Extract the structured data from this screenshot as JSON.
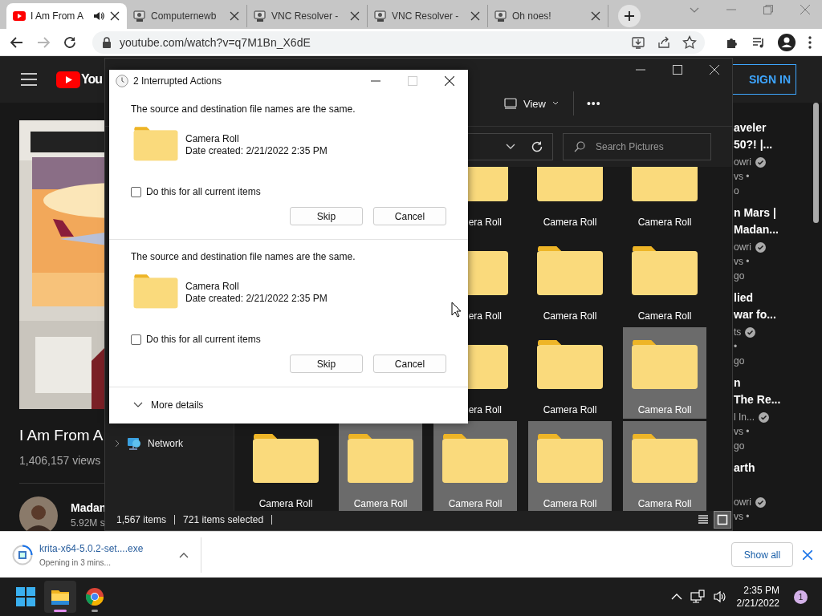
{
  "browser": {
    "tabs": [
      {
        "title": "I Am From A",
        "kind": "video",
        "audio": true,
        "selected": true
      },
      {
        "title": "Computernewb",
        "kind": "vnc",
        "audio": false,
        "selected": false
      },
      {
        "title": "VNC Resolver -",
        "kind": "vnc",
        "audio": false,
        "selected": false
      },
      {
        "title": "VNC Resolver -",
        "kind": "vnc",
        "audio": false,
        "selected": false
      },
      {
        "title": "Oh noes!",
        "kind": "vnc",
        "audio": false,
        "selected": false
      }
    ],
    "forward_disabled": true,
    "url": "youtube.com/watch?v=q7M1Bn_X6dE"
  },
  "youtube": {
    "logo": "You",
    "sign_in": "SIGN IN",
    "video": {
      "title": "I Am From A",
      "views": "1,406,157 views",
      "channel": "Madan",
      "subscribers": "5.92M s"
    },
    "suggestions": [
      {
        "title": [
          "aveler",
          "50?! |..."
        ],
        "meta": [
          {
            "text": "owri",
            "verified": true
          },
          {
            "text": "vs •",
            "verified": false
          },
          {
            "text": "o",
            "verified": false
          }
        ]
      },
      {
        "title": [
          "n Mars |",
          "Madan..."
        ],
        "meta": [
          {
            "text": "owri",
            "verified": true
          },
          {
            "text": "vs •",
            "verified": false
          },
          {
            "text": "go",
            "verified": false
          }
        ]
      },
      {
        "title": [
          "lied",
          "war fo..."
        ],
        "meta": [
          {
            "text": "ts",
            "verified": true
          },
          {
            "text": "•",
            "verified": false
          },
          {
            "text": "go",
            "verified": false
          }
        ]
      },
      {
        "title": [
          "n",
          "The Re..."
        ],
        "meta": [
          {
            "text": "l In...",
            "verified": true
          },
          {
            "text": "vs •",
            "verified": false
          },
          {
            "text": "go",
            "verified": false
          }
        ]
      },
      {
        "title": [
          "arth"
        ],
        "meta": [
          {
            "text": "owri",
            "verified": true
          },
          {
            "text": "vs •",
            "verified": false
          }
        ]
      }
    ]
  },
  "explorer": {
    "view": "View",
    "more": "•••",
    "search": {
      "placeholder": "Search Pictures"
    },
    "nav": [
      {
        "label": "Network",
        "expanded": false
      }
    ],
    "rows": [
      [
        "",
        "",
        {
          "label": "era Roll",
          "kind": "cut",
          "selected": false
        },
        {
          "label": "Camera Roll",
          "kind": "full",
          "selected": false
        },
        {
          "label": "Camera Roll",
          "kind": "full",
          "selected": false
        }
      ],
      [
        "",
        "",
        {
          "label": "era Roll",
          "kind": "cut",
          "selected": false
        },
        {
          "label": "Camera Roll",
          "kind": "full",
          "selected": false
        },
        {
          "label": "Camera Roll",
          "kind": "full",
          "selected": false
        }
      ],
      [
        "",
        "",
        {
          "label": "era Roll",
          "kind": "cut",
          "selected": false
        },
        {
          "label": "Camera Roll",
          "kind": "full",
          "selected": false
        },
        {
          "label": "Camera Roll",
          "kind": "full",
          "selected": true
        }
      ],
      [
        {
          "label": "Camera Roll",
          "kind": "full",
          "selected": false
        },
        {
          "label": "Camera Roll",
          "kind": "full",
          "selected": true
        },
        {
          "label": "Camera Roll",
          "kind": "full",
          "selected": true
        },
        {
          "label": "Camera Roll",
          "kind": "full",
          "selected": true
        },
        {
          "label": "Camera Roll",
          "kind": "full",
          "selected": true
        }
      ]
    ],
    "status": {
      "count": "1,567 items",
      "selected": "721 items selected"
    },
    "view_modes": [
      {
        "kind": "details",
        "selected": false
      },
      {
        "kind": "large_icons",
        "selected": true
      }
    ]
  },
  "dialog": {
    "title": "2 Interrupted Actions",
    "maximize_disabled": true,
    "conflicts": [
      {
        "message": "The source and destination file names are the same.",
        "name": "Camera Roll",
        "date": "Date created: 2/21/2022 2:35 PM",
        "apply_all_label": "Do this for all current items",
        "apply_all": false,
        "skip": "Skip",
        "cancel": "Cancel"
      },
      {
        "message": "The source and destination file names are the same.",
        "name": "Camera Roll",
        "date": "Date created: 2/21/2022 2:35 PM",
        "apply_all_label": "Do this for all current items",
        "apply_all": false,
        "skip": "Skip",
        "cancel": "Cancel"
      }
    ],
    "more_details": "More details"
  },
  "downloads": {
    "file": "krita-x64-5.0.2-set....exe",
    "status": "Opening in 3 mins...",
    "show_all": "Show all"
  },
  "taskbar": {
    "apps": [
      {
        "kind": "start"
      },
      {
        "kind": "explorer",
        "active": true
      },
      {
        "kind": "chrome",
        "active": false
      }
    ],
    "time": "2:35 PM",
    "date": "2/21/2022",
    "notifications": "1"
  }
}
